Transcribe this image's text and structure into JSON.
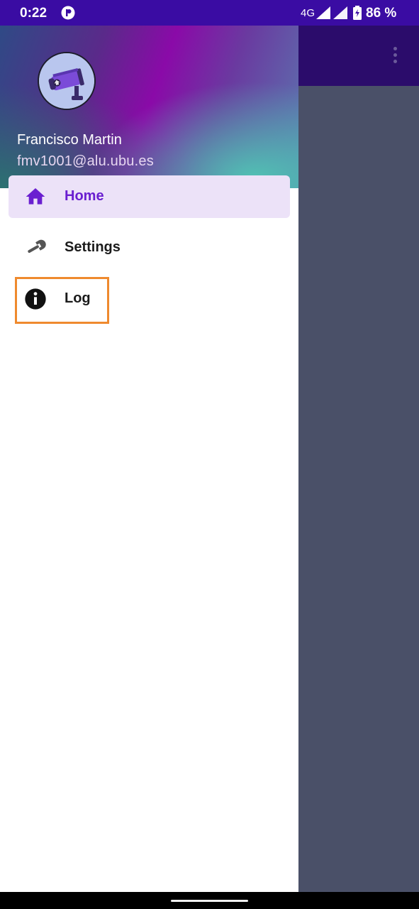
{
  "status_bar": {
    "time": "0:22",
    "network": "4G",
    "battery": "86 %",
    "icons": [
      "app-notification-icon",
      "signal-icon",
      "signal-icon",
      "battery-icon"
    ]
  },
  "app_bar": {
    "overflow_icon": "more-vert-icon"
  },
  "drawer": {
    "header": {
      "avatar_icon": "security-camera-icon",
      "user_name": "Francisco Martin",
      "user_email": "fmv1001@alu.ubu.es"
    },
    "items": [
      {
        "label": "Home",
        "icon": "home-icon",
        "selected": true
      },
      {
        "label": "Settings",
        "icon": "wrench-icon",
        "selected": false
      },
      {
        "label": "Log",
        "icon": "info-icon",
        "selected": false,
        "highlighted": true
      }
    ]
  },
  "colors": {
    "status_bar": "#3a0ca3",
    "toolbar": "#2b0c6b",
    "scrim": "#4a5068",
    "selected_bg": "#ece2f8",
    "selected_text": "#6a1fd0",
    "highlight_border": "#ef8a2e"
  }
}
